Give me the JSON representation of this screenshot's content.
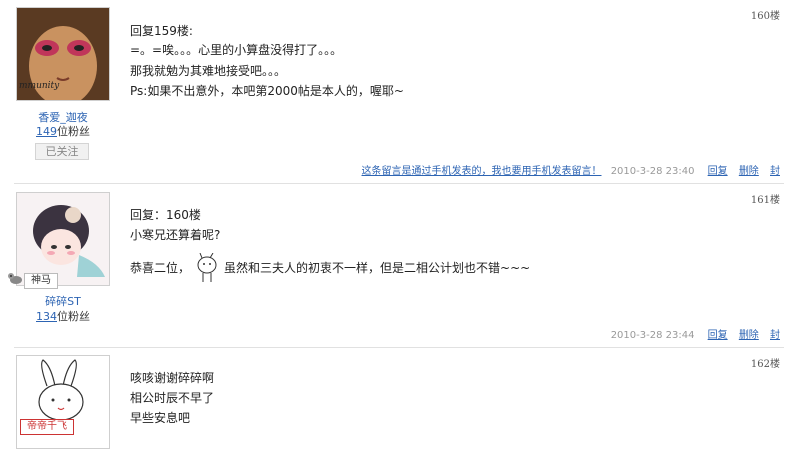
{
  "posts": [
    {
      "floor": "160楼",
      "username": "香爱_迦夜",
      "fans_count": "149",
      "fans_suffix": "位粉丝",
      "follow_label": "已关注",
      "avatar_text": "mmunity",
      "lines": [
        "回复159楼:",
        "=。=唉。。。心里的小算盘没得打了。。。",
        "那我就勉为其难地接受吧。。。",
        "Ps:如果不出意外，本吧第2000帖是本人的，喔耶~"
      ],
      "mobile_note": "这条留言是通过手机发表的，我也要用手机发表留言！",
      "time": "2010-3-28 23:40",
      "actions": [
        "回复",
        "删除",
        "封"
      ]
    },
    {
      "floor": "161楼",
      "username": "碎碎ST",
      "fans_count": "134",
      "fans_suffix": "位粉丝",
      "badge": "神马",
      "lines": [
        "回复：160楼",
        "小寒兄还算着呢?",
        "恭喜二位，",
        "虽然和三夫人的初衷不一样，但是二相公计划也不错~~~"
      ],
      "time": "2010-3-28 23:44",
      "actions": [
        "回复",
        "删除",
        "封"
      ]
    },
    {
      "floor": "162楼",
      "badge": "帝帝千飞",
      "lines": [
        "咳咳谢谢碎碎啊",
        "相公时辰不早了",
        "早些安息吧"
      ]
    }
  ],
  "colors": {
    "link": "#2d64b3",
    "divider": "#e1e1e1",
    "badge_red": "#cc3333"
  }
}
